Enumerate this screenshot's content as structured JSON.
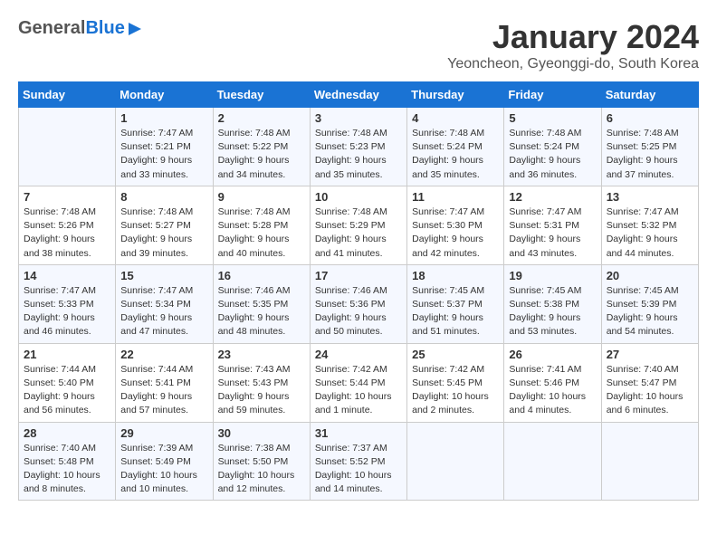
{
  "header": {
    "logo_general": "General",
    "logo_blue": "Blue",
    "month_title": "January 2024",
    "subtitle": "Yeoncheon, Gyeonggi-do, South Korea"
  },
  "days_of_week": [
    "Sunday",
    "Monday",
    "Tuesday",
    "Wednesday",
    "Thursday",
    "Friday",
    "Saturday"
  ],
  "weeks": [
    [
      {
        "day": "",
        "info": ""
      },
      {
        "day": "1",
        "info": "Sunrise: 7:47 AM\nSunset: 5:21 PM\nDaylight: 9 hours\nand 33 minutes."
      },
      {
        "day": "2",
        "info": "Sunrise: 7:48 AM\nSunset: 5:22 PM\nDaylight: 9 hours\nand 34 minutes."
      },
      {
        "day": "3",
        "info": "Sunrise: 7:48 AM\nSunset: 5:23 PM\nDaylight: 9 hours\nand 35 minutes."
      },
      {
        "day": "4",
        "info": "Sunrise: 7:48 AM\nSunset: 5:24 PM\nDaylight: 9 hours\nand 35 minutes."
      },
      {
        "day": "5",
        "info": "Sunrise: 7:48 AM\nSunset: 5:24 PM\nDaylight: 9 hours\nand 36 minutes."
      },
      {
        "day": "6",
        "info": "Sunrise: 7:48 AM\nSunset: 5:25 PM\nDaylight: 9 hours\nand 37 minutes."
      }
    ],
    [
      {
        "day": "7",
        "info": "Sunrise: 7:48 AM\nSunset: 5:26 PM\nDaylight: 9 hours\nand 38 minutes."
      },
      {
        "day": "8",
        "info": "Sunrise: 7:48 AM\nSunset: 5:27 PM\nDaylight: 9 hours\nand 39 minutes."
      },
      {
        "day": "9",
        "info": "Sunrise: 7:48 AM\nSunset: 5:28 PM\nDaylight: 9 hours\nand 40 minutes."
      },
      {
        "day": "10",
        "info": "Sunrise: 7:48 AM\nSunset: 5:29 PM\nDaylight: 9 hours\nand 41 minutes."
      },
      {
        "day": "11",
        "info": "Sunrise: 7:47 AM\nSunset: 5:30 PM\nDaylight: 9 hours\nand 42 minutes."
      },
      {
        "day": "12",
        "info": "Sunrise: 7:47 AM\nSunset: 5:31 PM\nDaylight: 9 hours\nand 43 minutes."
      },
      {
        "day": "13",
        "info": "Sunrise: 7:47 AM\nSunset: 5:32 PM\nDaylight: 9 hours\nand 44 minutes."
      }
    ],
    [
      {
        "day": "14",
        "info": "Sunrise: 7:47 AM\nSunset: 5:33 PM\nDaylight: 9 hours\nand 46 minutes."
      },
      {
        "day": "15",
        "info": "Sunrise: 7:47 AM\nSunset: 5:34 PM\nDaylight: 9 hours\nand 47 minutes."
      },
      {
        "day": "16",
        "info": "Sunrise: 7:46 AM\nSunset: 5:35 PM\nDaylight: 9 hours\nand 48 minutes."
      },
      {
        "day": "17",
        "info": "Sunrise: 7:46 AM\nSunset: 5:36 PM\nDaylight: 9 hours\nand 50 minutes."
      },
      {
        "day": "18",
        "info": "Sunrise: 7:45 AM\nSunset: 5:37 PM\nDaylight: 9 hours\nand 51 minutes."
      },
      {
        "day": "19",
        "info": "Sunrise: 7:45 AM\nSunset: 5:38 PM\nDaylight: 9 hours\nand 53 minutes."
      },
      {
        "day": "20",
        "info": "Sunrise: 7:45 AM\nSunset: 5:39 PM\nDaylight: 9 hours\nand 54 minutes."
      }
    ],
    [
      {
        "day": "21",
        "info": "Sunrise: 7:44 AM\nSunset: 5:40 PM\nDaylight: 9 hours\nand 56 minutes."
      },
      {
        "day": "22",
        "info": "Sunrise: 7:44 AM\nSunset: 5:41 PM\nDaylight: 9 hours\nand 57 minutes."
      },
      {
        "day": "23",
        "info": "Sunrise: 7:43 AM\nSunset: 5:43 PM\nDaylight: 9 hours\nand 59 minutes."
      },
      {
        "day": "24",
        "info": "Sunrise: 7:42 AM\nSunset: 5:44 PM\nDaylight: 10 hours\nand 1 minute."
      },
      {
        "day": "25",
        "info": "Sunrise: 7:42 AM\nSunset: 5:45 PM\nDaylight: 10 hours\nand 2 minutes."
      },
      {
        "day": "26",
        "info": "Sunrise: 7:41 AM\nSunset: 5:46 PM\nDaylight: 10 hours\nand 4 minutes."
      },
      {
        "day": "27",
        "info": "Sunrise: 7:40 AM\nSunset: 5:47 PM\nDaylight: 10 hours\nand 6 minutes."
      }
    ],
    [
      {
        "day": "28",
        "info": "Sunrise: 7:40 AM\nSunset: 5:48 PM\nDaylight: 10 hours\nand 8 minutes."
      },
      {
        "day": "29",
        "info": "Sunrise: 7:39 AM\nSunset: 5:49 PM\nDaylight: 10 hours\nand 10 minutes."
      },
      {
        "day": "30",
        "info": "Sunrise: 7:38 AM\nSunset: 5:50 PM\nDaylight: 10 hours\nand 12 minutes."
      },
      {
        "day": "31",
        "info": "Sunrise: 7:37 AM\nSunset: 5:52 PM\nDaylight: 10 hours\nand 14 minutes."
      },
      {
        "day": "",
        "info": ""
      },
      {
        "day": "",
        "info": ""
      },
      {
        "day": "",
        "info": ""
      }
    ]
  ]
}
